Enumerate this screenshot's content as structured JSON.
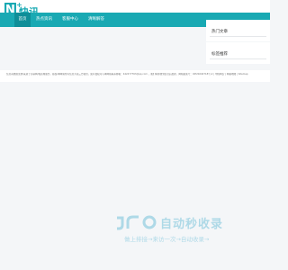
{
  "header": {
    "logo": {
      "letter": "N",
      "plus": "+",
      "text": "快讯"
    },
    "nav": [
      {
        "label": "首页",
        "active": true
      },
      {
        "label": "热点资讯",
        "active": false
      },
      {
        "label": "客服中心",
        "active": false
      },
      {
        "label": "清晰解答",
        "active": false
      }
    ]
  },
  "sidebar": {
    "cards": [
      {
        "title": "热门文章"
      },
      {
        "title": "标签推荐"
      }
    ]
  },
  "info": {
    "text": "信息系统由注册/来源于互联网/和商城服务，版权/本网站所有信息为第三方提供，如有侵权可与本网站联系邮箱：442477763@qq.com ，我们将在收到信息后处理，网站备案号：ICP20240718号-2 | 中国网安 | 网站地图 | Sitemap"
  },
  "watermark": {
    "main": "自动秒收录",
    "sub": "做上排接→来访一次→自动收录→"
  },
  "colors": {
    "brand": "#19a9b3",
    "nav_active": "#0f8e98",
    "background": "#f4f6f8",
    "watermark": "#2fa4c8"
  }
}
